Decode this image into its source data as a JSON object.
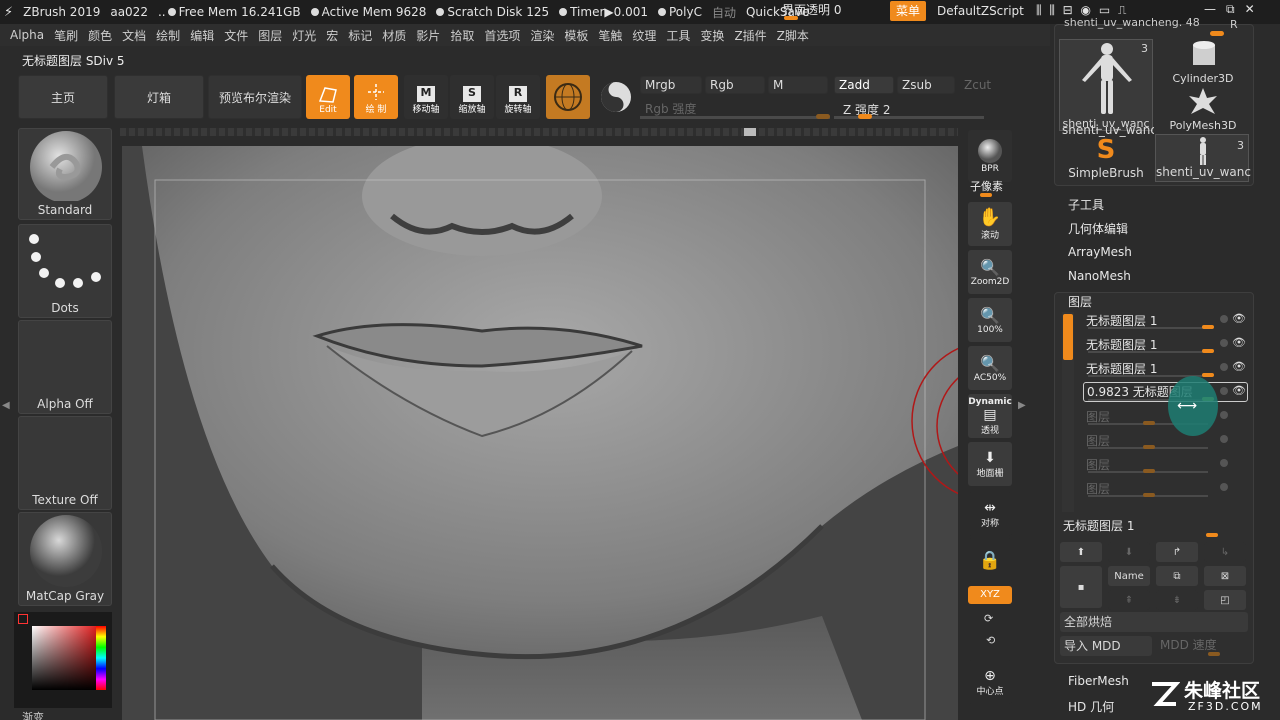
{
  "titlebar": {
    "app": "ZBrush 2019",
    "doc": "aa022",
    "free_mem": "Free Mem 16.241GB",
    "active_mem": "Active Mem 9628",
    "scratch": "Scratch Disk 125",
    "timer": "Timer▶0.001",
    "polyc": "PolyC",
    "auto": "自动",
    "quicksave": "QuickSave",
    "ui_trans": "界面透明 0",
    "menu_btn": "菜单",
    "script": "DefaultZScript"
  },
  "menu": [
    "Alpha",
    "笔刷",
    "颜色",
    "文档",
    "绘制",
    "编辑",
    "文件",
    "图层",
    "灯光",
    "宏",
    "标记",
    "材质",
    "影片",
    "拾取",
    "首选项",
    "渲染",
    "模板",
    "笔触",
    "纹理",
    "工具",
    "变换",
    "Z插件",
    "Z脚本"
  ],
  "subtitle": "无标题图层 SDiv 5",
  "shelf": {
    "home": "主页",
    "lightbox": "灯箱",
    "bpr": "预览布尔渲染"
  },
  "tools": {
    "edit": "Edit",
    "draw": "绘 制",
    "move": "移动轴",
    "scale": "缩放轴",
    "rotate": "旋转轴",
    "m_letter": "M",
    "s_letter": "S",
    "r_letter": "R"
  },
  "color_modes": {
    "mrgb": "Mrgb",
    "rgb": "Rgb",
    "m": "M",
    "rgb_strength": "Rgb 强度",
    "zadd": "Zadd",
    "zsub": "Zsub",
    "zcut": "Zcut",
    "z_strength": "Z 强度 2"
  },
  "left": {
    "brush": "Standard",
    "stroke": "Dots",
    "alpha": "Alpha Off",
    "texture": "Texture Off",
    "material": "MatCap Gray",
    "gradient": "渐变"
  },
  "right_shelf": {
    "bpr": "BPR",
    "subpixel": "子像素",
    "scroll": "滚动",
    "zoom2d": "Zoom2D",
    "p100": "100%",
    "ac50": "AC50%",
    "dynamic": "Dynamic",
    "persp": "透视",
    "floor": "地面栅",
    "frame": "对称",
    "lock": "",
    "xyz": "XYZ",
    "center": "中心点"
  },
  "tool_panel": {
    "shenti_top": "shenti_uv_wancheng. 48",
    "t1": "shenti_uv_wanc",
    "t1_count": "3",
    "t2": "Cylinder3D",
    "t3": "shenti_uv_wanc",
    "t4": "PolyMesh3D",
    "t5": "SimpleBrush",
    "t6": "shenti_uv_wanc",
    "t6_count": "3",
    "r_btn": "R"
  },
  "panel_items": {
    "subtool": "子工具",
    "geom": "几何体编辑",
    "array": "ArrayMesh",
    "nano": "NanoMesh",
    "layers": "图层"
  },
  "layers": [
    {
      "name": "无标题图层 1"
    },
    {
      "name": "无标题图层 1"
    },
    {
      "name": "无标题图层 1"
    },
    {
      "name": "0.9823 无标题图层"
    },
    {
      "name": "图层"
    },
    {
      "name": "图层"
    },
    {
      "name": "图层"
    },
    {
      "name": "图层"
    }
  ],
  "layer_footer": {
    "current": "无标题图层 1",
    "name_btn": "Name",
    "bake_all": "全部烘焙",
    "import_mdd": "导入 MDD",
    "mdd_speed": "MDD 速度"
  },
  "bottom_items": {
    "fiber": "FiberMesh",
    "hd": "HD 几何"
  },
  "watermark": {
    "brand": "朱峰社区",
    "url": "ZF3D.COM"
  }
}
